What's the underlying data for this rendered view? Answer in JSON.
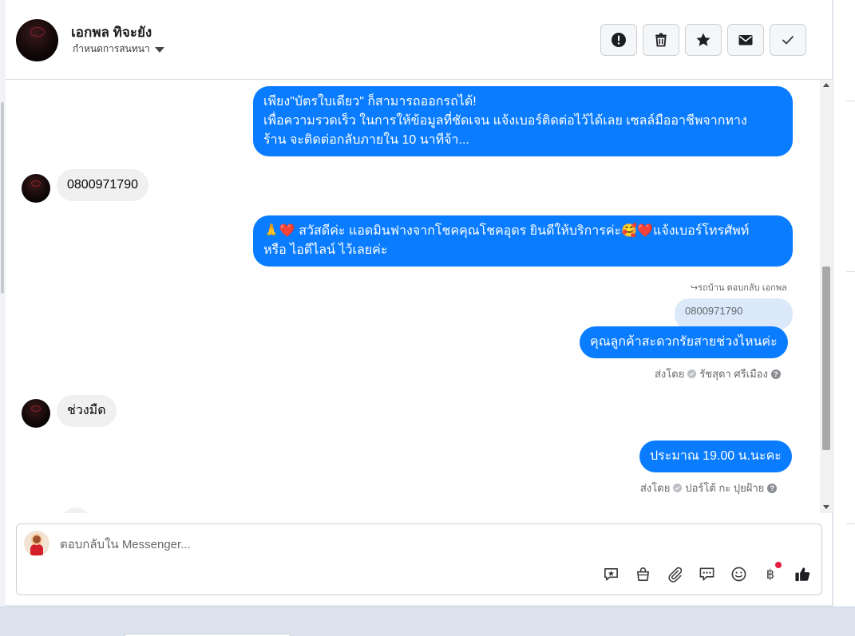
{
  "header": {
    "contact_name": "เอกพล ทิจะยัง",
    "assign_label": "กำหนดการสนทนา",
    "actions": [
      {
        "name": "report-button",
        "icon": "alert-icon"
      },
      {
        "name": "delete-button",
        "icon": "trash-icon"
      },
      {
        "name": "star-button",
        "icon": "star-icon"
      },
      {
        "name": "mark-unread-button",
        "icon": "envelope-icon"
      },
      {
        "name": "mark-done-button",
        "icon": "check-icon"
      }
    ]
  },
  "messages": {
    "m1": "เพียง\"บัตรใบเดียว\" ก็สามารถออกรถได้!\nเพื่อความรวดเร็ว ในการให้ข้อมูลที่ชัดเจน แจ้งเบอร์ติดต่อไว้ได้เลย เซลล์มืออาชีพจากทาง\nร้าน จะติดต่อกลับภายใน 10 นาทีจ้า...",
    "m2": "0800971790",
    "m3": "🙏❤️ สวัสดีค่ะ แอดมินฟางจากโชคคุณโชคอุดร ยินดีให้บริการค่ะ🥰❤️แจ้งเบอร์โทรศัพท์\nหรือ ไอดีไลน์  ไว้เลยค่ะ",
    "reply_note": "↪รถบ้าน ตอบกลับ เอกพล",
    "quoted": "0800971790",
    "m4": "คุณลูกค้าสะดวกรัยสายช่วงไหนค่ะ",
    "m4_sent_by": "ส่งโดย",
    "m4_sender": "รัชสุดา ศรีเมือง",
    "m5": "ช่วงมืด",
    "m6": "ประมาณ 19.00 น.นะคะ",
    "m6_sent_by": "ส่งโดย",
    "m6_sender": "ปอร์โต้ กะ ปุยฝ้าย"
  },
  "composer": {
    "placeholder": "ตอบกลับใน Messenger...",
    "tools": [
      "saved-reply-icon",
      "shop-bag-icon",
      "attach-icon",
      "chat-bubbles-icon",
      "emoji-icon",
      "baht-icon",
      "thumbs-up-icon"
    ]
  },
  "colors": {
    "outgoing": "#0a7cff",
    "incoming": "#f0f0f0",
    "badge": "#e41e3f"
  }
}
